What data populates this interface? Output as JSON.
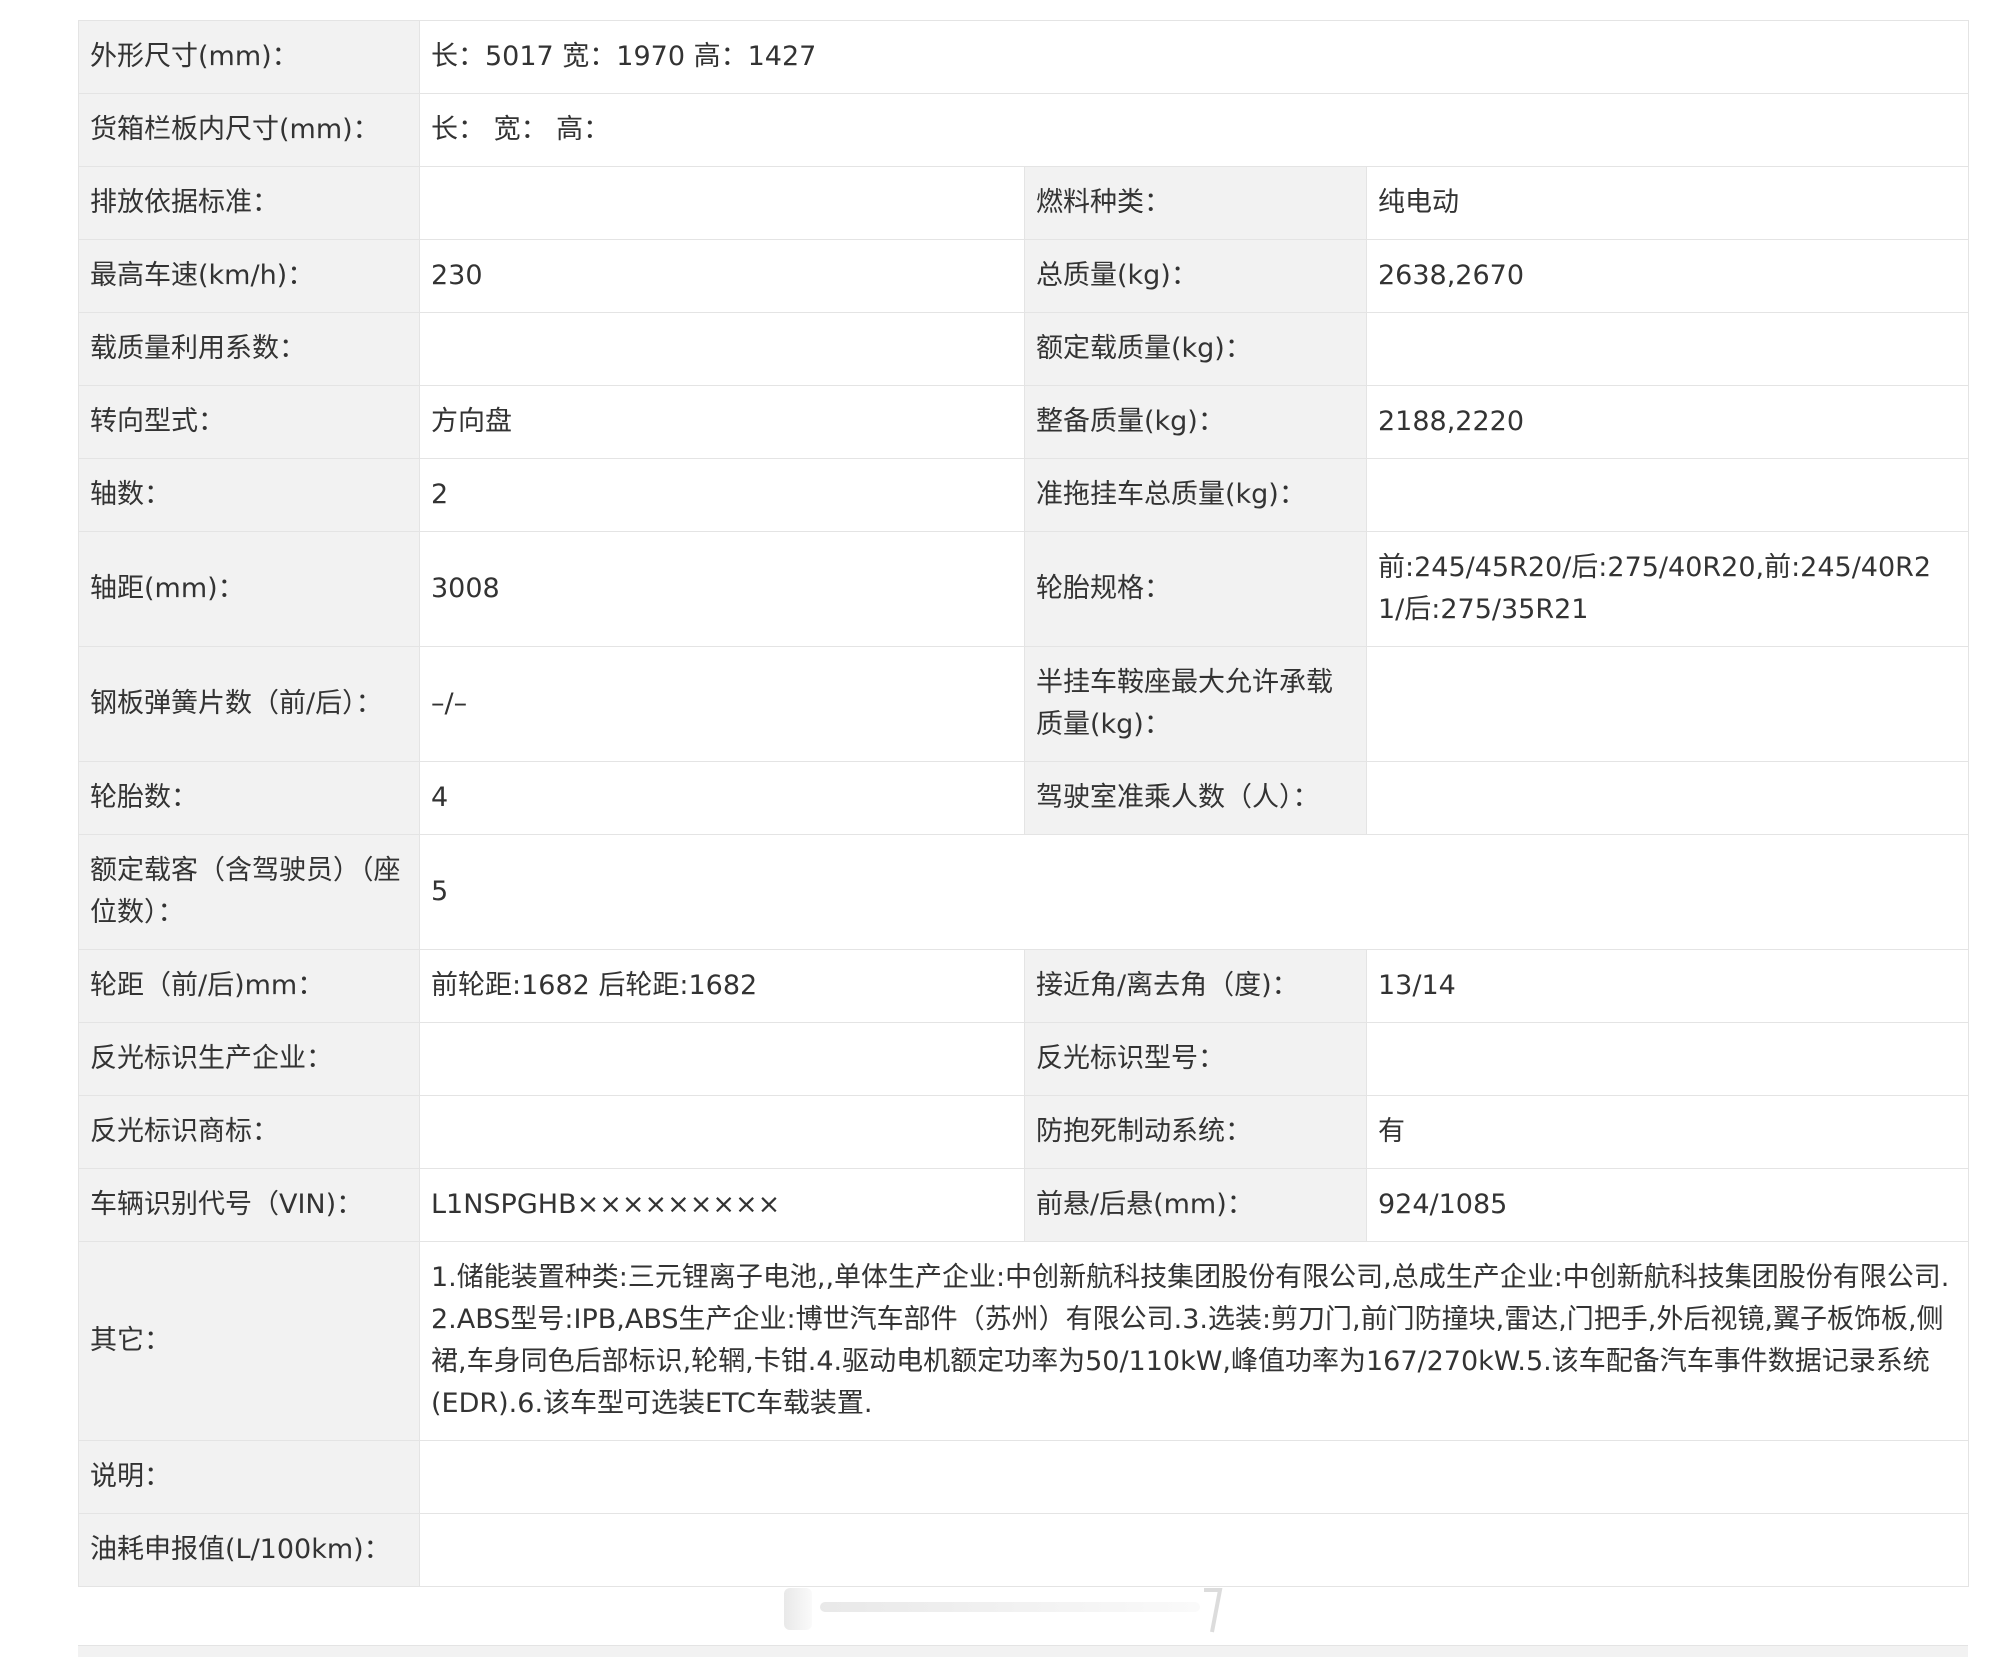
{
  "rows": [
    {
      "l1": "外形尺寸(mm)：",
      "v1": "长：5017 宽：1970 高：1427"
    },
    {
      "l1": "货箱栏板内尺寸(mm)：",
      "v1": "长：   宽：   高："
    },
    {
      "l1": "排放依据标准：",
      "v1": "",
      "l2": "燃料种类：",
      "v2": "纯电动"
    },
    {
      "l1": "最高车速(km/h)：",
      "v1": "230",
      "l2": "总质量(kg)：",
      "v2": "2638,2670"
    },
    {
      "l1": "载质量利用系数：",
      "v1": "",
      "l2": "额定载质量(kg)：",
      "v2": ""
    },
    {
      "l1": "转向型式：",
      "v1": "方向盘",
      "l2": "整备质量(kg)：",
      "v2": "2188,2220"
    },
    {
      "l1": "轴数：",
      "v1": "2",
      "l2": "准拖挂车总质量(kg)：",
      "v2": ""
    },
    {
      "l1": "轴距(mm)：",
      "v1": "3008",
      "l2": "轮胎规格：",
      "v2": "前:245/45R20/后:275/40R20,前:245/40R21/后:275/35R21"
    },
    {
      "l1": "钢板弹簧片数（前/后）：",
      "v1": "–/–",
      "l2": "半挂车鞍座最大允许承载质量(kg)：",
      "v2": ""
    },
    {
      "l1": "轮胎数：",
      "v1": "4",
      "l2": "驾驶室准乘人数（人）：",
      "v2": ""
    },
    {
      "l1": "额定载客（含驾驶员）（座位数）：",
      "v1": "5"
    },
    {
      "l1": "轮距（前/后)mm：",
      "v1": "前轮距:1682 后轮距:1682",
      "l2": "接近角/离去角（度)：",
      "v2": "13/14"
    },
    {
      "l1": "反光标识生产企业：",
      "v1": "",
      "l2": "反光标识型号：",
      "v2": ""
    },
    {
      "l1": "反光标识商标：",
      "v1": "",
      "l2": "防抱死制动系统：",
      "v2": "有"
    },
    {
      "l1": "车辆识别代号（VIN)：",
      "v1": "L1NSPGHB×××××××××",
      "l2": "前悬/后悬(mm)：",
      "v2": "924/1085"
    },
    {
      "l1": "其它：",
      "v1": "1.储能装置种类:三元锂离子电池,,单体生产企业:中创新航科技集团股份有限公司,总成生产企业:中创新航科技集团股份有限公司.2.ABS型号:IPB,ABS生产企业:博世汽车部件（苏州）有限公司.3.选装:剪刀门,前门防撞块,雷达,门把手,外后视镜,翼子板饰板,侧裙,车身同色后部标识,轮辋,卡钳.4.驱动电机额定功率为50/110kW,峰值功率为167/270kW.5.该车配备汽车事件数据记录系统(EDR).6.该车型可选装ETC车载装置."
    },
    {
      "l1": "说明：",
      "v1": ""
    },
    {
      "l1": "油耗申报值(L/100km)：",
      "v1": ""
    }
  ],
  "watermark": {
    "icon": "weibo-watermark-icon"
  }
}
